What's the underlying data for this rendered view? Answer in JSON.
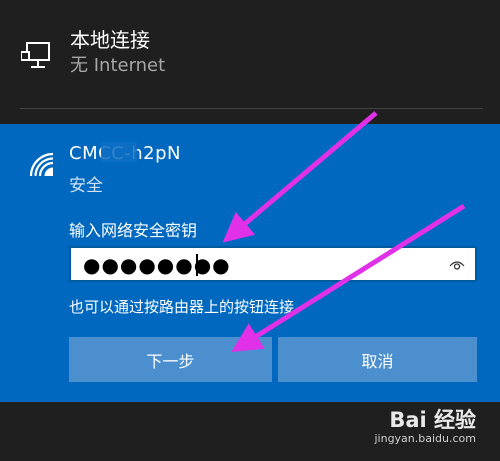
{
  "ethernet": {
    "title": "本地连接",
    "status": "无 Internet",
    "icon": "ethernet-monitor-icon"
  },
  "wifi": {
    "ssid": "CMCC-h2pN",
    "security": "安全",
    "icon": "wifi-icon",
    "prompt": "输入网络安全密钥",
    "password_masked": "●●●●●●●●",
    "reveal_icon": "eye-icon",
    "hint": "也可以通过按路由器上的按钮连接。",
    "buttons": {
      "next_label": "下一步",
      "cancel_label": "取消"
    }
  },
  "watermark": {
    "logo": "Bai 经验",
    "url": "jingyan.baidu.com"
  },
  "colors": {
    "panel_blue": "#0068bf",
    "button_blue": "#4c8fcf",
    "background_dark": "#1f1f1f",
    "arrow_magenta": "#e030e8"
  }
}
